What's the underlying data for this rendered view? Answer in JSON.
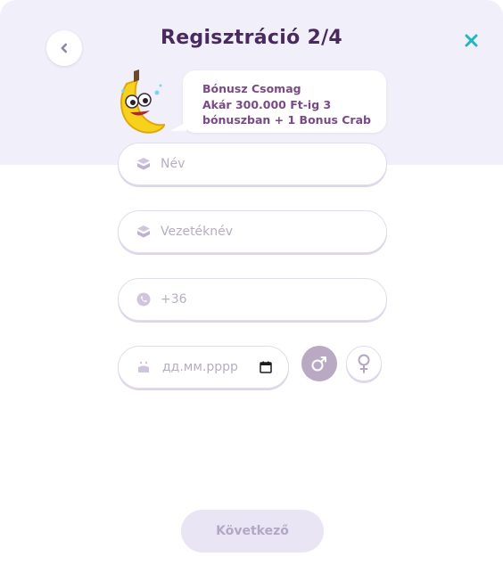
{
  "header": {
    "title": "Regisztráció 2/4",
    "back_icon": "chevron-left-icon",
    "close_icon": "close-icon"
  },
  "promo": {
    "mascot": "banana-mascot",
    "line1": "Bónusz Csomag",
    "line2": "Akár 300.000 Ft-ig 3",
    "line3": "bónuszban + 1 Bonus Crab"
  },
  "form": {
    "first_name": {
      "placeholder": "Név",
      "value": "",
      "icon": "user-card-icon"
    },
    "last_name": {
      "placeholder": "Vezetéknév",
      "value": "",
      "icon": "user-card-icon"
    },
    "phone": {
      "placeholder": "+36",
      "value": "",
      "icon": "phone-icon"
    },
    "birthdate": {
      "placeholder": "дд.мм.рррр",
      "icon": "cake-icon",
      "calendar_icon": "calendar-icon"
    },
    "gender": {
      "selected": "male",
      "options": [
        "male",
        "female"
      ]
    }
  },
  "footer": {
    "next_label": "Következő"
  },
  "colors": {
    "accent_close": "#1fb7c4",
    "title": "#4a2a5e",
    "header_bg": "#f1eff9",
    "disabled_button_bg": "#e9e5f4",
    "gender_selected_bg": "#b9a9c2"
  }
}
